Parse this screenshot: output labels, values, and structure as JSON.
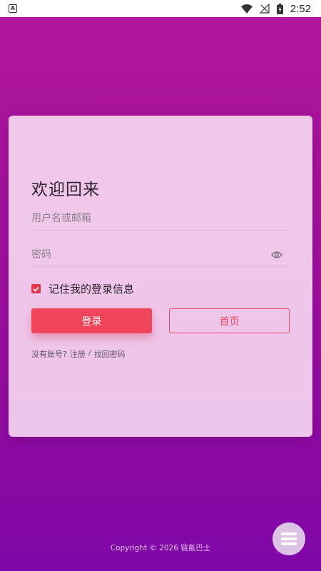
{
  "status_bar": {
    "app_icon_letter": "A",
    "time": "2:52",
    "icons": [
      "wifi-icon",
      "no-signal-icon",
      "battery-charging-icon"
    ]
  },
  "login": {
    "title": "欢迎回来",
    "username_placeholder": "用户名或邮箱",
    "password_placeholder": "密码",
    "remember_label": "记住我的登录信息",
    "remember_checked": true,
    "login_button": "登录",
    "home_button": "首页",
    "no_account_text": "没有账号?",
    "register_link": "注册",
    "separator": "/",
    "forgot_link": "找回密码"
  },
  "footer": {
    "copyright": "Copyright © 2026 链氪巴士"
  },
  "colors": {
    "accent": "#f0445a",
    "background_top": "#b0179c",
    "background_bottom": "#7f06a8",
    "card": "#f6d6f0"
  }
}
